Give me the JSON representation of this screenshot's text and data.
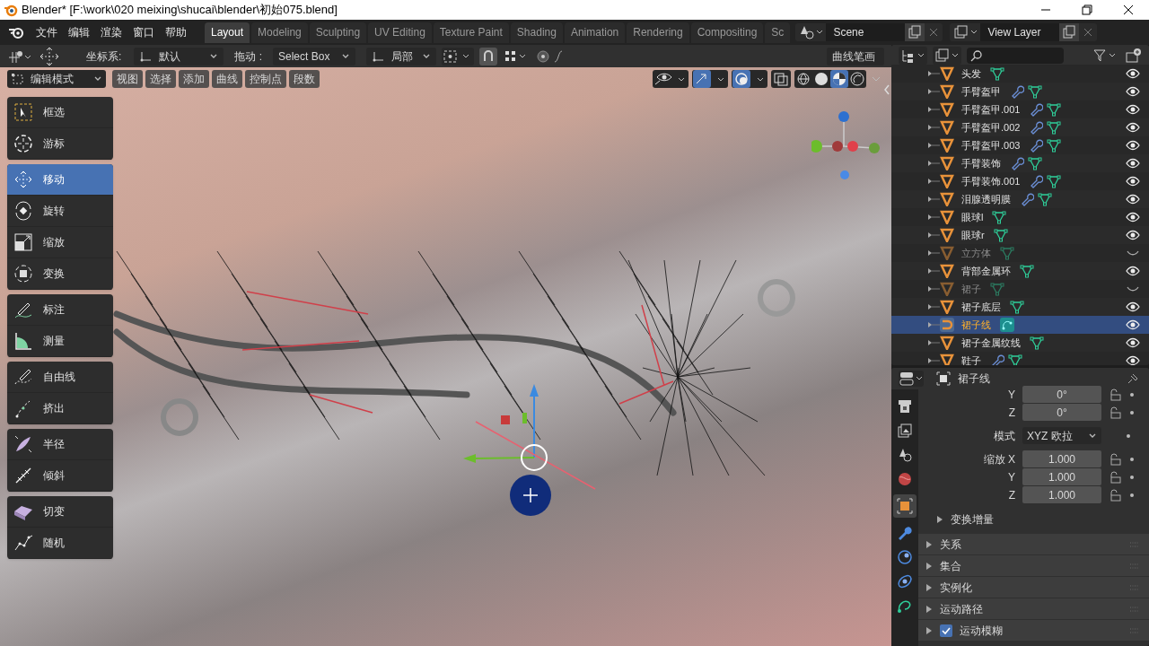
{
  "window": {
    "title": "Blender* [F:\\work\\020 meixing\\shucai\\blender\\初始075.blend]"
  },
  "menus": [
    "文件",
    "编辑",
    "渲染",
    "窗口",
    "帮助"
  ],
  "workspaces": [
    {
      "label": "Layout",
      "selected": true
    },
    {
      "label": "Modeling",
      "selected": false
    },
    {
      "label": "Sculpting",
      "selected": false
    },
    {
      "label": "UV Editing",
      "selected": false
    },
    {
      "label": "Texture Paint",
      "selected": false
    },
    {
      "label": "Shading",
      "selected": false
    },
    {
      "label": "Animation",
      "selected": false
    },
    {
      "label": "Rendering",
      "selected": false
    },
    {
      "label": "Compositing",
      "selected": false
    },
    {
      "label": "Sc",
      "selected": false
    }
  ],
  "scene": "Scene",
  "view_layer": "View Layer",
  "tool_header": {
    "orientation_label": "坐标系:",
    "orientation": "默认",
    "drag_label": "拖动 :",
    "drag": "Select Box",
    "pivot": "局部",
    "stroke": "曲线笔画"
  },
  "edit_header": {
    "mode": "编辑模式",
    "menus": [
      "视图",
      "选择",
      "添加",
      "曲线",
      "控制点",
      "段数"
    ]
  },
  "shading_modes": [
    {
      "kind": "wireframe",
      "selected": false
    },
    {
      "kind": "solid",
      "selected": false
    },
    {
      "kind": "material",
      "selected": true
    },
    {
      "kind": "rendered",
      "selected": false
    }
  ],
  "tool_groups": [
    [
      {
        "kind": "select",
        "label": "框选",
        "selected": false
      },
      {
        "kind": "cursor",
        "label": "游标",
        "selected": false
      }
    ],
    [
      {
        "kind": "move",
        "label": "移动",
        "selected": true
      },
      {
        "kind": "rotate",
        "label": "旋转",
        "selected": false
      },
      {
        "kind": "scale",
        "label": "缩放",
        "selected": false
      },
      {
        "kind": "transform",
        "label": "变换",
        "selected": false
      }
    ],
    [
      {
        "kind": "annotate",
        "label": "标注",
        "selected": false
      },
      {
        "kind": "measure",
        "label": "测量",
        "selected": false
      }
    ],
    [
      {
        "kind": "draw",
        "label": "自由线",
        "selected": false
      },
      {
        "kind": "extrude",
        "label": "挤出",
        "selected": false
      }
    ],
    [
      {
        "kind": "radius",
        "label": "半径",
        "selected": false
      },
      {
        "kind": "tilt",
        "label": "倾斜",
        "selected": false
      }
    ],
    [
      {
        "kind": "shear",
        "label": "切变",
        "selected": false
      },
      {
        "kind": "randomize",
        "label": "随机",
        "selected": false
      }
    ]
  ],
  "outliner": {
    "items": [
      {
        "name": "头发",
        "kind": "mesh",
        "modifier": false,
        "visible": true,
        "selected": false
      },
      {
        "name": "手臂盔甲",
        "kind": "mesh",
        "modifier": true,
        "visible": true,
        "selected": false
      },
      {
        "name": "手臂盔甲.001",
        "kind": "mesh",
        "modifier": true,
        "visible": true,
        "selected": false
      },
      {
        "name": "手臂盔甲.002",
        "kind": "mesh",
        "modifier": true,
        "visible": true,
        "selected": false
      },
      {
        "name": "手臂盔甲.003",
        "kind": "mesh",
        "modifier": true,
        "visible": true,
        "selected": false
      },
      {
        "name": "手臂装饰",
        "kind": "mesh",
        "modifier": true,
        "visible": true,
        "selected": false
      },
      {
        "name": "手臂装饰.001",
        "kind": "mesh",
        "modifier": true,
        "visible": true,
        "selected": false
      },
      {
        "name": "泪腺透明膜",
        "kind": "mesh",
        "modifier": true,
        "visible": true,
        "selected": false
      },
      {
        "name": "眼球l",
        "kind": "mesh",
        "modifier": false,
        "visible": true,
        "selected": false
      },
      {
        "name": "眼球r",
        "kind": "mesh",
        "modifier": false,
        "visible": true,
        "selected": false
      },
      {
        "name": "立方体",
        "kind": "mesh",
        "modifier": false,
        "visible": false,
        "selected": false
      },
      {
        "name": "背部金属环",
        "kind": "mesh",
        "modifier": false,
        "visible": true,
        "selected": false
      },
      {
        "name": "裙子",
        "kind": "mesh",
        "modifier": false,
        "visible": false,
        "selected": false
      },
      {
        "name": "裙子底层",
        "kind": "mesh",
        "modifier": false,
        "visible": true,
        "selected": false
      },
      {
        "name": "裙子线",
        "kind": "curve",
        "modifier": false,
        "visible": true,
        "selected": true
      },
      {
        "name": "裙子金属纹线",
        "kind": "mesh",
        "modifier": false,
        "visible": true,
        "selected": false
      },
      {
        "name": "鞋子",
        "kind": "mesh",
        "modifier": true,
        "visible": true,
        "selected": false
      }
    ]
  },
  "properties": {
    "object": "裙子线",
    "tabs": [
      {
        "kind": "render",
        "selected": false
      },
      {
        "kind": "output",
        "selected": false
      },
      {
        "kind": "scene",
        "selected": false
      },
      {
        "kind": "world",
        "selected": false
      },
      {
        "kind": "object",
        "selected": true
      },
      {
        "kind": "modifier",
        "selected": false
      },
      {
        "kind": "particles",
        "selected": false
      },
      {
        "kind": "physics",
        "selected": false
      },
      {
        "kind": "data",
        "selected": false
      }
    ],
    "fields": [
      {
        "label": "Y",
        "value": "0°",
        "kind": "number"
      },
      {
        "label": "Z",
        "value": "0°",
        "kind": "number"
      },
      {
        "label": "模式",
        "value": "XYZ 欧拉",
        "kind": "dropdown"
      },
      {
        "label": "缩放 X",
        "value": "1.000",
        "kind": "number"
      },
      {
        "label": "Y",
        "value": "1.000",
        "kind": "number"
      },
      {
        "label": "Z",
        "value": "1.000",
        "kind": "number"
      }
    ],
    "subpanel": {
      "label": "变换增量",
      "expanded": false
    },
    "panels": [
      {
        "label": "关系",
        "expanded": false
      },
      {
        "label": "集合",
        "expanded": false
      },
      {
        "label": "实例化",
        "expanded": false
      },
      {
        "label": "运动路径",
        "expanded": false
      },
      {
        "label": "运动模糊",
        "expanded": false,
        "checked": true
      }
    ]
  }
}
